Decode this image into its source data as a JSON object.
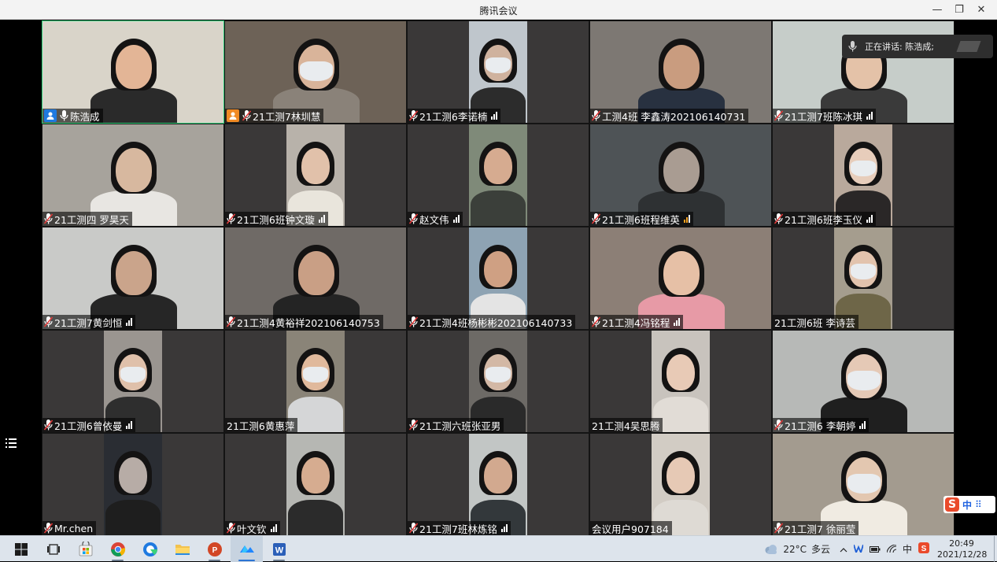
{
  "window": {
    "title": "腾讯会议",
    "minimize": "—",
    "restore": "❐",
    "close": "✕"
  },
  "speaking": {
    "label": "正在讲话: 陈浩成;"
  },
  "tiles": [
    {
      "name": "陈浩成",
      "mic": true,
      "host": "blue",
      "active": true,
      "signal": false,
      "layout": "full",
      "bg": "#d9d4c9",
      "skin": "#e3b596",
      "cloth": "#2a2a2a",
      "hair": true,
      "mask": false
    },
    {
      "name": "21工测7林圳慧",
      "mic": true,
      "host": "orange",
      "signal": false,
      "layout": "full",
      "bg": "#6d6257",
      "skin": "#d9b49a",
      "cloth": "#8a8279",
      "hair": true,
      "mask": true
    },
    {
      "name": "21工测6李诺楠",
      "mic": true,
      "signal": "white",
      "layout": "narrow",
      "bg": "#bfc6cc",
      "skin": "#cfb29e",
      "cloth": "#2c2c2c",
      "hair": true,
      "mask": true
    },
    {
      "name": "工测4班 李鑫涛202106140731",
      "mic": true,
      "signal": false,
      "layout": "full",
      "bg": "#7d7873",
      "skin": "#c99c7f",
      "cloth": "#283140",
      "hair": true,
      "mask": false
    },
    {
      "name": "21工测7班陈冰琪",
      "mic": true,
      "signal": "white",
      "layout": "full",
      "bg": "#c6cdc9",
      "skin": "#e4c2a8",
      "cloth": "#3a3a3a",
      "hair": true,
      "mask": false
    },
    {
      "name": "21工测四 罗昊天",
      "mic": true,
      "signal": false,
      "layout": "full",
      "bg": "#a7a39c",
      "skin": "#d7b89f",
      "cloth": "#e8e6e2",
      "hair": true,
      "mask": false
    },
    {
      "name": "21工测6班钟文璇",
      "mic": true,
      "signal": "white",
      "layout": "narrow",
      "bg": "#b8b2aa",
      "skin": "#e1c1aa",
      "cloth": "#e9e5dc",
      "hair": true,
      "mask": false
    },
    {
      "name": "赵文伟",
      "mic": true,
      "signal": "white",
      "layout": "narrow",
      "bg": "#7f8a79",
      "skin": "#d6ab90",
      "cloth": "#3b3f3a",
      "hair": true,
      "mask": false
    },
    {
      "name": "21工测6班程维英",
      "mic": true,
      "signal": "orange",
      "layout": "full",
      "bg": "#4e5356",
      "skin": "#a99c92",
      "cloth": "#2e3133",
      "hair": true,
      "mask": false
    },
    {
      "name": "21工测6班李玉仪",
      "mic": true,
      "signal": "white",
      "layout": "narrow",
      "bg": "#b9a99c",
      "skin": "#e7cdbb",
      "cloth": "#2a2727",
      "hair": true,
      "mask": true
    },
    {
      "name": "21工测7黄剑恒",
      "mic": true,
      "signal": "white",
      "layout": "full",
      "bg": "#c9cac8",
      "skin": "#caa48b",
      "cloth": "#262626",
      "hair": true,
      "mask": false
    },
    {
      "name": "21工测4黄裕祥202106140753",
      "mic": true,
      "signal": false,
      "layout": "full",
      "bg": "#6f6a66",
      "skin": "#c99f85",
      "cloth": "#242424",
      "hair": true,
      "mask": false
    },
    {
      "name": "21工测4班杨彬彬202106140733",
      "mic": true,
      "signal": false,
      "layout": "narrow",
      "bg": "#8ea3b3",
      "skin": "#cfa083",
      "cloth": "#e4e4e4",
      "hair": true,
      "mask": false
    },
    {
      "name": "21工测4冯铭程",
      "mic": true,
      "signal": "white",
      "layout": "full",
      "bg": "#8c7f76",
      "skin": "#e6c0a6",
      "cloth": "#e79aa6",
      "hair": true,
      "mask": false
    },
    {
      "name": "21工测6班 李诗芸",
      "mic": false,
      "signal": false,
      "layout": "narrow",
      "bg": "#a59d8e",
      "skin": "#e2c3ad",
      "cloth": "#6e6648",
      "hair": true,
      "mask": true
    },
    {
      "name": "21工测6曾依曼",
      "mic": true,
      "signal": "white",
      "layout": "narrow",
      "bg": "#9a9590",
      "skin": "#dfc0aa",
      "cloth": "#2e2e2e",
      "hair": true,
      "mask": true
    },
    {
      "name": "21工测6黄惠萍",
      "mic": false,
      "signal": false,
      "layout": "narrow",
      "bg": "#8a8478",
      "skin": "#e0b99c",
      "cloth": "#d5d6d7",
      "hair": true,
      "mask": true
    },
    {
      "name": "21工测六班张亚男",
      "mic": true,
      "signal": false,
      "layout": "narrow",
      "bg": "#6d6a66",
      "skin": "#d3b8a5",
      "cloth": "#2a2a2a",
      "hair": true,
      "mask": true
    },
    {
      "name": "21工测4吴思腾",
      "mic": false,
      "signal": false,
      "layout": "narrow",
      "bg": "#c8c3bd",
      "skin": "#e8cab6",
      "cloth": "#e1dcd6",
      "hair": true,
      "mask": false
    },
    {
      "name": "21工测6 李朝婷",
      "mic": true,
      "signal": "white",
      "layout": "full",
      "bg": "#b7b9b7",
      "skin": "#e5c9b6",
      "cloth": "#1f1f1f",
      "hair": true,
      "mask": true
    },
    {
      "name": "Mr.chen",
      "mic": true,
      "signal": false,
      "layout": "narrow",
      "bg": "#2a2d33",
      "skin": "#b7aca6",
      "cloth": "#1e1e1e",
      "hair": true,
      "mask": false
    },
    {
      "name": "叶文钦",
      "mic": true,
      "signal": "white",
      "layout": "narrow",
      "bg": "#b6b7b3",
      "skin": "#d6ac90",
      "cloth": "#2b2b2b",
      "hair": true,
      "mask": false
    },
    {
      "name": "21工测7班林炼铭",
      "mic": true,
      "signal": "white",
      "layout": "narrow",
      "bg": "#c2c6c5",
      "skin": "#d2a98f",
      "cloth": "#33383b",
      "hair": true,
      "mask": false
    },
    {
      "name": "会议用户907184",
      "mic": false,
      "signal": false,
      "layout": "narrow",
      "bg": "#d2ccc4",
      "skin": "#e6c9b5",
      "cloth": "#dedad4",
      "hair": true,
      "mask": false
    },
    {
      "name": "21工测7 徐丽莹",
      "mic": true,
      "signal": false,
      "layout": "full",
      "bg": "#a39b8f",
      "skin": "#e3c7b0",
      "cloth": "#f0ebe2",
      "hair": true,
      "mask": true
    }
  ],
  "ime": {
    "logo": "S",
    "mode": "中",
    "menu": "⠿"
  },
  "taskbar": {
    "apps": [
      {
        "name": "start",
        "running": false
      },
      {
        "name": "task-view",
        "running": false
      },
      {
        "name": "microsoft-store",
        "running": false
      },
      {
        "name": "chrome",
        "running": true
      },
      {
        "name": "edge",
        "running": false
      },
      {
        "name": "file-explorer",
        "running": false
      },
      {
        "name": "powerpoint",
        "running": true
      },
      {
        "name": "tencent-meeting",
        "running": true,
        "selected": true
      },
      {
        "name": "word",
        "running": true
      }
    ],
    "weather": {
      "temp": "22°C",
      "desc": "多云"
    },
    "tray_ime": "中",
    "time": "20:49",
    "date": "2021/12/28"
  }
}
